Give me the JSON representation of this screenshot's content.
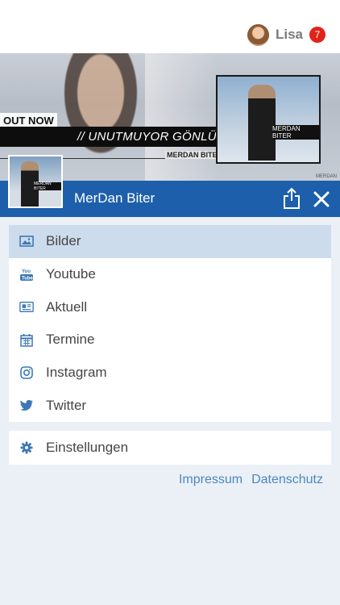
{
  "user": {
    "name": "Lisa",
    "notifications": "7"
  },
  "banner": {
    "out_now": "OUT NOW",
    "title": "// UNUTMUYOR GÖNLÜM",
    "artist": "MERDAN BITER",
    "cover_label": "MERDAN BITER",
    "credit": "MERDAN"
  },
  "header": {
    "title": "MerDan Biter"
  },
  "menu": {
    "items": [
      {
        "label": "Bilder",
        "icon": "image-icon"
      },
      {
        "label": "Youtube",
        "icon": "youtube-icon"
      },
      {
        "label": "Aktuell",
        "icon": "newspaper-icon"
      },
      {
        "label": "Termine",
        "icon": "calendar-icon"
      },
      {
        "label": "Instagram",
        "icon": "instagram-icon"
      },
      {
        "label": "Twitter",
        "icon": "twitter-icon"
      }
    ],
    "settings_label": "Einstellungen"
  },
  "footer": {
    "impressum": "Impressum",
    "datenschutz": "Datenschutz"
  },
  "colors": {
    "accent": "#1d5fab",
    "active_row": "#cddcec",
    "link": "#4d87be",
    "badge": "#e2231a",
    "background": "#ebf0f7"
  }
}
